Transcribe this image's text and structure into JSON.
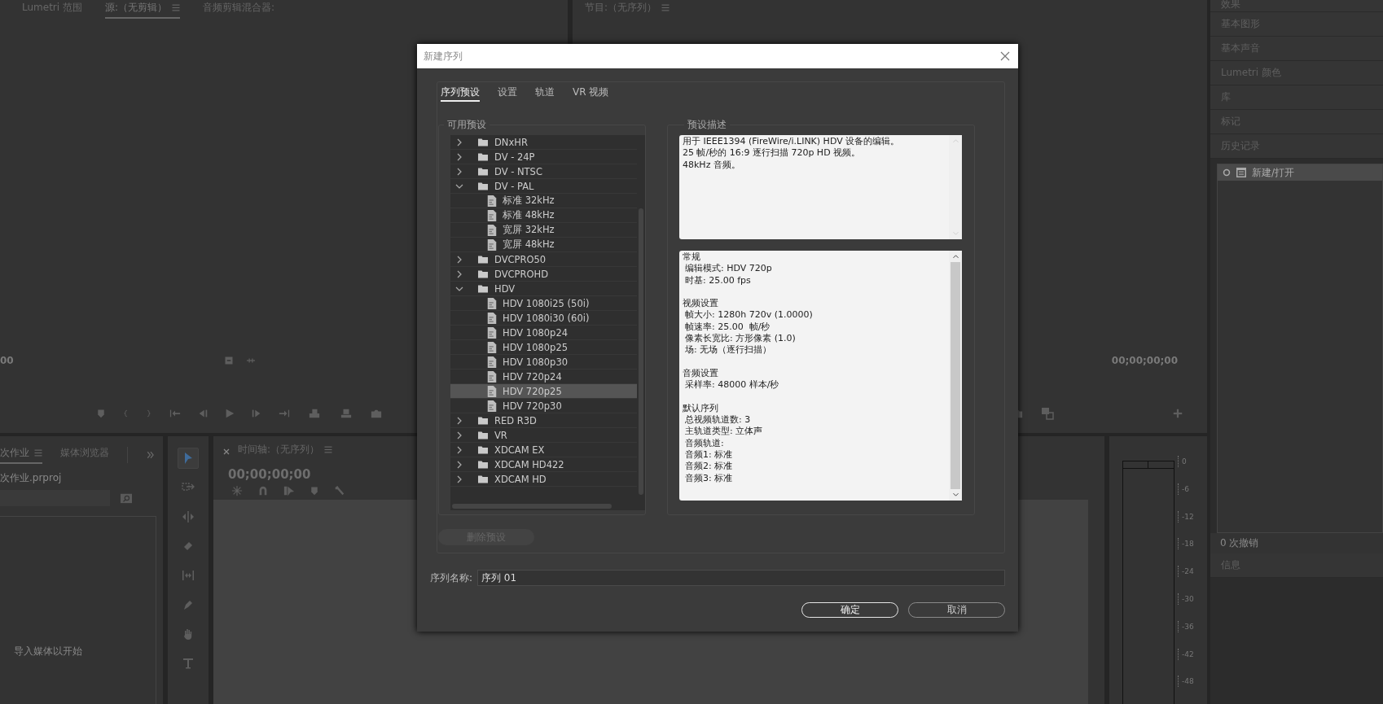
{
  "background": {
    "source_monitor": {
      "tabs": [
        {
          "label": "Lumetri 范围",
          "selected": false,
          "menu": false
        },
        {
          "label": "源:（无剪辑）",
          "selected": true,
          "menu": true
        },
        {
          "label": "音频剪辑混合器:",
          "selected": false,
          "menu": false
        }
      ],
      "timecode": "00"
    },
    "program_monitor": {
      "title": "节目:（无序列）",
      "menu": true,
      "timecode": "00;00;00;00"
    },
    "right_panels": {
      "panels": [
        {
          "label": "效果"
        },
        {
          "label": "基本图形"
        },
        {
          "label": "基本声音"
        },
        {
          "label": "Lumetri 颜色"
        },
        {
          "label": "库"
        },
        {
          "label": "标记"
        },
        {
          "label": "历史记录"
        }
      ],
      "history": [
        {
          "label": "新建/打开",
          "selected": true
        }
      ],
      "undo_count": "0 次撤销",
      "info_panel": "信息"
    },
    "project_panel": {
      "tabs": [
        {
          "label": "次作业",
          "selected": true,
          "menu": true
        },
        {
          "label": "媒体浏览器",
          "selected": false,
          "menu": false
        }
      ],
      "file_name": "次作业.prproj",
      "empty_message": "导入媒体以开始"
    },
    "tools": [
      {
        "kind": "selection",
        "selected": true
      },
      {
        "kind": "track_select",
        "selected": false
      },
      {
        "kind": "ripple",
        "selected": false
      },
      {
        "kind": "razor",
        "selected": false
      },
      {
        "kind": "slip",
        "selected": false
      },
      {
        "kind": "pen",
        "selected": false
      },
      {
        "kind": "hand",
        "selected": false
      },
      {
        "kind": "type",
        "selected": false
      }
    ],
    "timeline": {
      "title": "时间轴:（无序列）",
      "timecode": "00;00;00;00"
    },
    "audio_meter": {
      "scale": [
        "0",
        "-6",
        "-12",
        "-18",
        "-24",
        "-30",
        "-36",
        "-42",
        "-48"
      ]
    }
  },
  "dialog": {
    "title": "新建序列",
    "tabs": [
      {
        "label": "序列预设",
        "selected": true
      },
      {
        "label": "设置",
        "selected": false
      },
      {
        "label": "轨道",
        "selected": false
      },
      {
        "label": "VR 视频",
        "selected": false
      }
    ],
    "presets": {
      "title": "可用预设",
      "tree": [
        {
          "kind": "folder",
          "label": "DNxHR",
          "expanded": false,
          "selected": false
        },
        {
          "kind": "folder",
          "label": "DV - 24P",
          "expanded": false,
          "selected": false
        },
        {
          "kind": "folder",
          "label": "DV - NTSC",
          "expanded": false,
          "selected": false
        },
        {
          "kind": "folder",
          "label": "DV - PAL",
          "expanded": true,
          "selected": false,
          "children": [
            {
              "kind": "preset",
              "label": "标准 32kHz",
              "selected": false
            },
            {
              "kind": "preset",
              "label": "标准 48kHz",
              "selected": false
            },
            {
              "kind": "preset",
              "label": "宽屏 32kHz",
              "selected": false
            },
            {
              "kind": "preset",
              "label": "宽屏 48kHz",
              "selected": false
            }
          ]
        },
        {
          "kind": "folder",
          "label": "DVCPRO50",
          "expanded": false,
          "selected": false
        },
        {
          "kind": "folder",
          "label": "DVCPROHD",
          "expanded": false,
          "selected": false
        },
        {
          "kind": "folder",
          "label": "HDV",
          "expanded": true,
          "selected": false,
          "children": [
            {
              "kind": "preset",
              "label": "HDV 1080i25 (50i)",
              "selected": false
            },
            {
              "kind": "preset",
              "label": "HDV 1080i30 (60i)",
              "selected": false
            },
            {
              "kind": "preset",
              "label": "HDV 1080p24",
              "selected": false
            },
            {
              "kind": "preset",
              "label": "HDV 1080p25",
              "selected": false
            },
            {
              "kind": "preset",
              "label": "HDV 1080p30",
              "selected": false
            },
            {
              "kind": "preset",
              "label": "HDV 720p24",
              "selected": false
            },
            {
              "kind": "preset",
              "label": "HDV 720p25",
              "selected": true
            },
            {
              "kind": "preset",
              "label": "HDV 720p30",
              "selected": false
            }
          ]
        },
        {
          "kind": "folder",
          "label": "RED R3D",
          "expanded": false,
          "selected": false
        },
        {
          "kind": "folder",
          "label": "VR",
          "expanded": false,
          "selected": false
        },
        {
          "kind": "folder",
          "label": "XDCAM EX",
          "expanded": false,
          "selected": false
        },
        {
          "kind": "folder",
          "label": "XDCAM HD422",
          "expanded": false,
          "selected": false
        },
        {
          "kind": "folder",
          "label": "XDCAM HD",
          "expanded": false,
          "selected": false
        }
      ]
    },
    "description": {
      "title": "预设描述",
      "lines": [
        "用于 IEEE1394 (FireWire/i.LINK) HDV 设备的编辑。",
        "25 帧/秒的 16:9 逐行扫描 720p HD 视频。",
        "48kHz 音频。"
      ],
      "details": [
        {
          "kind": "heading",
          "text": "常规",
          "gap_before": false
        },
        {
          "kind": "item",
          "text": "编辑模式: HDV 720p"
        },
        {
          "kind": "item",
          "text": "时基: 25.00 fps"
        },
        {
          "kind": "heading",
          "text": "视频设置",
          "gap_before": true
        },
        {
          "kind": "item",
          "text": "帧大小: 1280h 720v (1.0000)"
        },
        {
          "kind": "item",
          "text": "帧速率: 25.00  帧/秒"
        },
        {
          "kind": "item",
          "text": "像素长宽比: 方形像素 (1.0)"
        },
        {
          "kind": "item",
          "text": "场: 无场（逐行扫描）"
        },
        {
          "kind": "heading",
          "text": "音频设置",
          "gap_before": true
        },
        {
          "kind": "item",
          "text": "采样率: 48000 样本/秒"
        },
        {
          "kind": "heading",
          "text": "默认序列",
          "gap_before": true
        },
        {
          "kind": "item",
          "text": "总视频轨道数: 3"
        },
        {
          "kind": "item",
          "text": "主轨道类型: 立体声"
        },
        {
          "kind": "item",
          "text": "音频轨道:"
        },
        {
          "kind": "item",
          "text": "音频1: 标准"
        },
        {
          "kind": "item",
          "text": "音频2: 标准"
        },
        {
          "kind": "item",
          "text": "音频3: 标准"
        }
      ]
    },
    "delete_button": {
      "label": "删除预设",
      "disabled": true
    },
    "sequence_name": {
      "label": "序列名称:",
      "value": "序列 01"
    },
    "buttons": [
      {
        "label": "确定",
        "default": true
      },
      {
        "label": "取消",
        "default": false
      }
    ]
  }
}
